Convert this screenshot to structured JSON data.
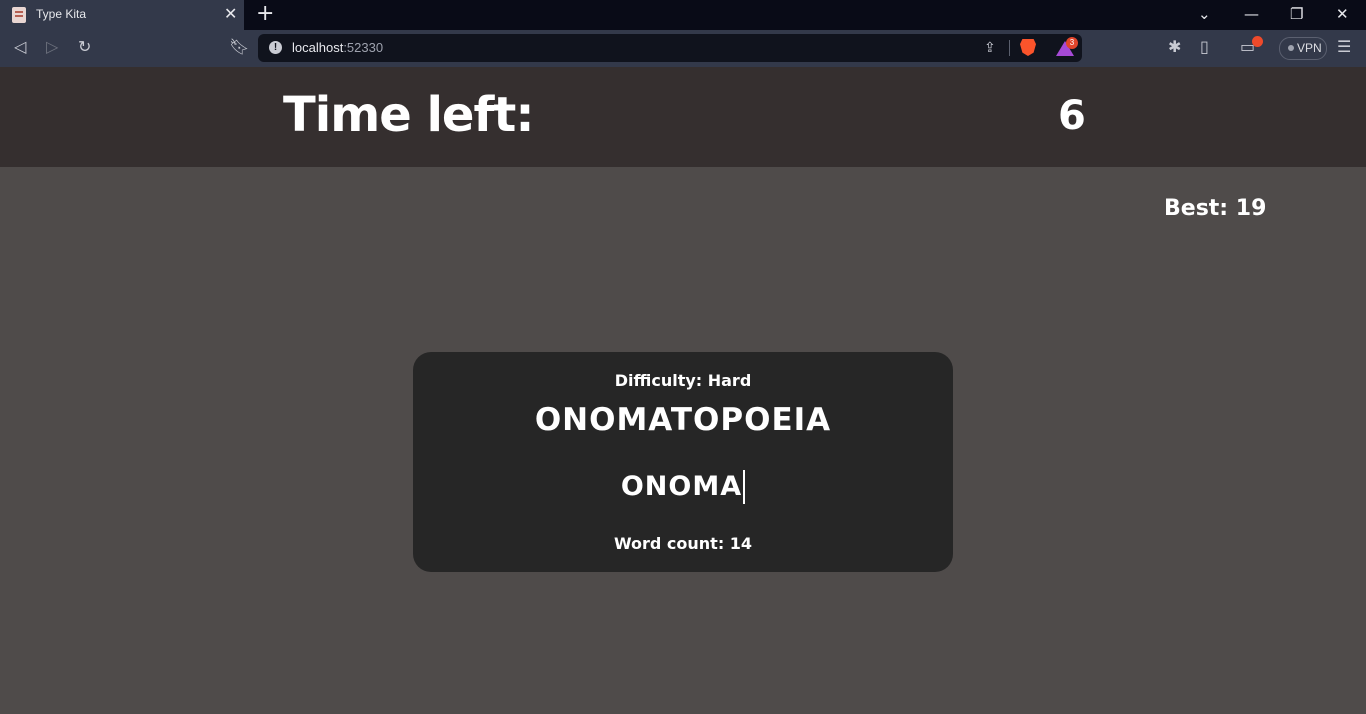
{
  "browser": {
    "tab_title": "Type Kita",
    "tab_close_icon": "close-icon",
    "new_tab_icon": "plus-icon",
    "url_host": "localhost",
    "url_port": ":52330",
    "rewards_badge_count": "3",
    "vpn_label": "VPN"
  },
  "header": {
    "time_label": "Time left:",
    "time_value": "6"
  },
  "best": {
    "label": "Best: 19"
  },
  "game": {
    "difficulty": "Difficulty: Hard",
    "word": "ONOMATOPOEIA",
    "typed": "ONOMA",
    "word_count": "Word count: 14"
  },
  "colors": {
    "page_bg": "#4f4b4a",
    "header_bg": "#352f2f",
    "card_bg": "#262626",
    "text": "#ffffff"
  }
}
